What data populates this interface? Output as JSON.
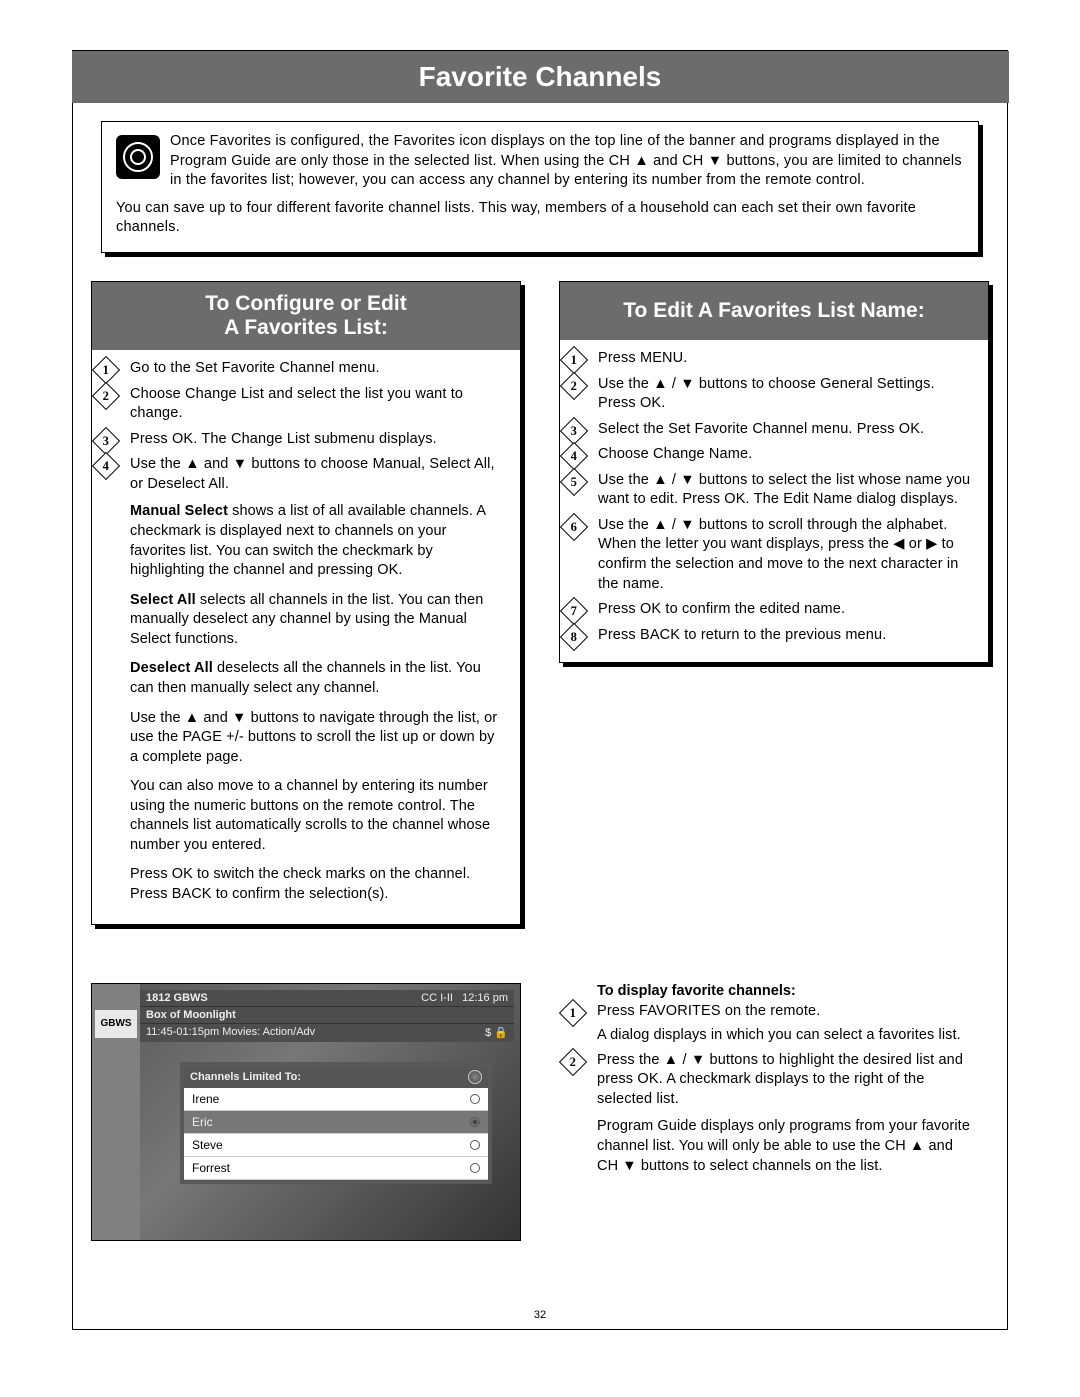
{
  "title": "Favorite Channels",
  "intro": {
    "p1": "Once Favorites is configured, the Favorites icon displays on the top line of the banner and programs displayed in the Program Guide are only those in the selected list. When using the CH ▲ and CH ▼ buttons, you are limited to channels in the favorites list; however, you can access any channel by entering its number from the remote control.",
    "p2": "You can save up to four different favorite channel lists. This way, members of a household can each set their own favorite channels."
  },
  "left": {
    "heading_line1": "To Configure or Edit",
    "heading_line2": "A Favorites List:",
    "steps": [
      "Go to the Set Favorite Channel menu.",
      "Choose Change List and select the list you want to change.",
      "Press OK. The Change List submenu displays.",
      "Use the ▲ and ▼ buttons to choose Manual, Select All, or Deselect All."
    ],
    "paras": {
      "manual_bold": "Manual Select",
      "manual": " shows a list of all available channels. A checkmark is displayed next to channels on your favorites list. You can switch the checkmark by highlighting the channel and pressing OK.",
      "selectall_bold": "Select All",
      "selectall": " selects all channels in the list. You can then manually deselect any channel by using the Manual Select functions.",
      "deselect_bold": "Deselect All",
      "deselect": " deselects all the channels in the list. You can then manually select any channel.",
      "nav": "Use the ▲ and ▼ buttons to navigate through the list, or use the PAGE +/- buttons to scroll the list up or down by a complete page.",
      "num": "You can also move to a channel by entering its number using the numeric buttons on the remote control. The channels list automatically scrolls to the channel whose number you entered.",
      "ok": "Press OK to switch the check marks on the channel. Press BACK to confirm the selection(s)."
    }
  },
  "right": {
    "heading": "To Edit A Favorites List Name:",
    "steps": [
      "Press MENU.",
      "Use the ▲ / ▼ buttons to choose General Settings. Press OK.",
      "Select the Set Favorite Channel menu. Press OK.",
      "Choose Change Name.",
      "Use the ▲ / ▼ buttons to select the list whose name you want to edit. Press OK. The Edit Name dialog displays.",
      "Use the ▲ / ▼ buttons to scroll through the alphabet. When the letter you want displays, press the ◀ or ▶ to confirm the selection and move to the next character in the name.",
      "Press OK to confirm the edited name.",
      "Press BACK to return to the previous menu."
    ]
  },
  "guide": {
    "logo": "GBWS",
    "channel": "1812 GBWS",
    "program": "Box of Moonlight",
    "time_genre": "11:45-01:15pm  Movies: Action/Adv",
    "clock": "12:16 pm",
    "cc": "CC  I-II",
    "dialog_title": "Channels Limited To:",
    "names": [
      "Irene",
      "Eric",
      "Steve",
      "Forrest"
    ],
    "selected_index": 1
  },
  "display_section": {
    "heading": "To display favorite channels:",
    "step1": "Press FAVORITES on the remote.",
    "step1b": "A dialog displays in which you can select a favorites list.",
    "step2": "Press the ▲ / ▼ buttons to highlight the desired list and press OK. A checkmark displays to the right of the selected list.",
    "tail": "Program Guide displays only programs from your favorite channel list. You will only be able to use the CH ▲ and CH ▼ buttons to select channels on the list."
  },
  "page_number": "32"
}
